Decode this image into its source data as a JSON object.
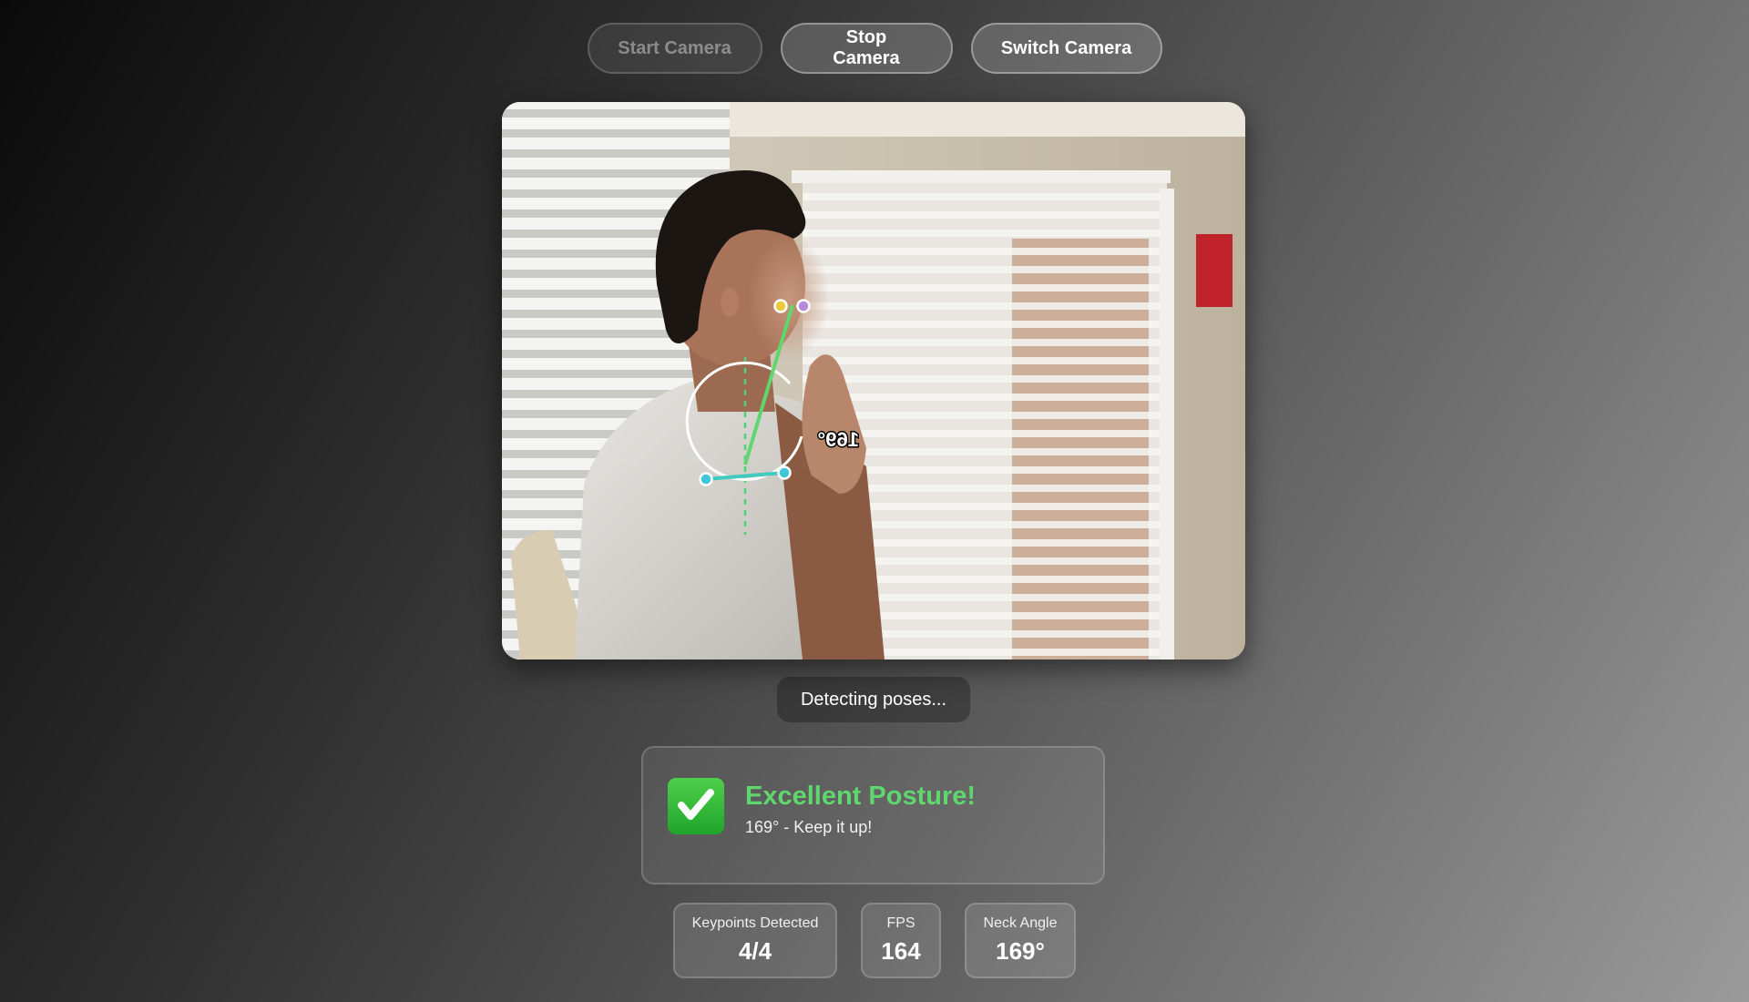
{
  "controls": {
    "start_label": "Start Camera",
    "stop_label": "Stop Camera",
    "switch_label": "Switch Camera"
  },
  "video": {
    "angle_overlay": "169°",
    "keypoints": [
      "left-ear",
      "right-ear",
      "left-shoulder",
      "right-shoulder"
    ]
  },
  "status": {
    "text": "Detecting poses..."
  },
  "posture": {
    "icon": "check-mark-icon",
    "title": "Excellent Posture!",
    "message": "169° - Keep it up!",
    "accent": "#5fd66e"
  },
  "stats": {
    "keypoints_label": "Keypoints Detected",
    "keypoints_value": "4/4",
    "fps_label": "FPS",
    "fps_value": "164",
    "neck_label": "Neck Angle",
    "neck_value": "169°"
  }
}
